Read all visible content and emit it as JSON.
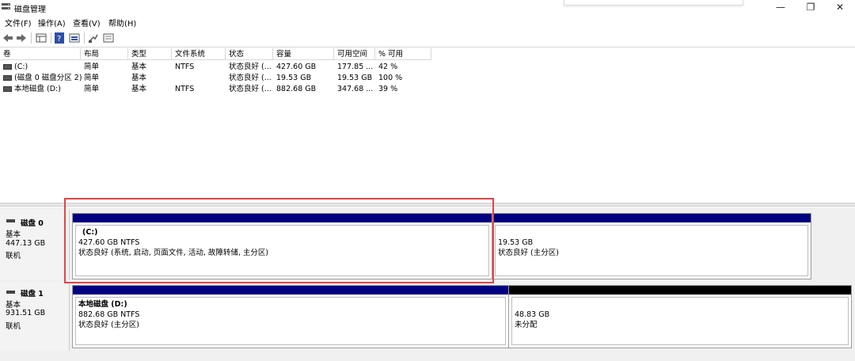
{
  "window": {
    "title": "磁盘管理",
    "minimize": "—",
    "restore": "❐",
    "close": "✕"
  },
  "menu": [
    "文件(F)",
    "操作(A)",
    "查看(V)",
    "帮助(H)"
  ],
  "toolbar": [
    "back-icon",
    "forward-icon",
    "volume-list-icon",
    "help-icon",
    "graph-view-icon",
    "rescan-icon",
    "properties-icon"
  ],
  "columns": [
    "卷",
    "布局",
    "类型",
    "文件系统",
    "状态",
    "容量",
    "可用空间",
    "% 可用"
  ],
  "volumes": [
    {
      "name": "(C:)",
      "layout": "简单",
      "type": "基本",
      "fs": "NTFS",
      "status": "状态良好 (...",
      "capacity": "427.60 GB",
      "free": "177.85 ...",
      "pct": "42 %"
    },
    {
      "name": "(磁盘 0 磁盘分区 2)",
      "layout": "简单",
      "type": "基本",
      "fs": "",
      "status": "状态良好 (...",
      "capacity": "19.53 GB",
      "free": "19.53 GB",
      "pct": "100 %"
    },
    {
      "name": "本地磁盘 (D:)",
      "layout": "简单",
      "type": "基本",
      "fs": "NTFS",
      "status": "状态良好 (...",
      "capacity": "882.68 GB",
      "free": "347.68 ...",
      "pct": "39 %"
    }
  ],
  "disks": [
    {
      "name": "磁盘 0",
      "type": "基本",
      "size": "447.13 GB",
      "state": "联机",
      "partitions": [
        {
          "title": "(C:)",
          "size": "427.60 GB NTFS",
          "status": "状态良好 (系统, 启动, 页面文件, 活动, 故障转储, 主分区)",
          "bar_color": "#000080"
        },
        {
          "title": "",
          "size": "19.53 GB",
          "status": "状态良好 (主分区)",
          "bar_color": "#000080"
        }
      ]
    },
    {
      "name": "磁盘 1",
      "type": "基本",
      "size": "931.51 GB",
      "state": "联机",
      "partitions": [
        {
          "title": "本地磁盘  (D:)",
          "size": "882.68 GB NTFS",
          "status": "状态良好 (主分区)",
          "bar_color": "#000080"
        },
        {
          "title": "",
          "size": "48.83 GB",
          "status": "未分配",
          "bar_color": "#000000"
        }
      ]
    }
  ],
  "highlight_color": "#e04545"
}
